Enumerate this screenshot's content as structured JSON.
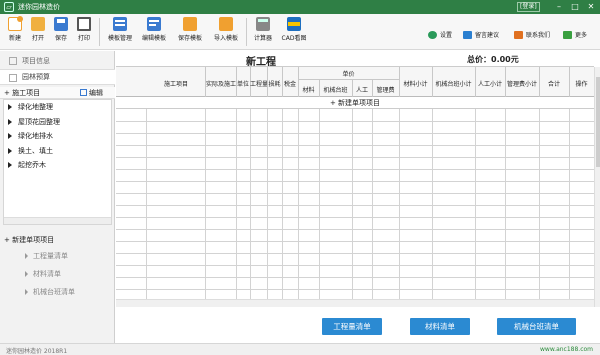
{
  "app": {
    "title": "迷你园林造价",
    "login": "[登录]"
  },
  "toolbar": {
    "items": [
      {
        "label": "新建",
        "icon": "new-file-icon",
        "color": "#f0a030"
      },
      {
        "label": "打开",
        "icon": "open-folder-icon",
        "color": "#f0b040"
      },
      {
        "label": "保存",
        "icon": "save-icon",
        "color": "#3a7ad0"
      },
      {
        "label": "打印",
        "icon": "print-icon",
        "color": "#555555"
      },
      {
        "label": "模板管理",
        "icon": "template-manage-icon",
        "color": "#3a7ad0"
      },
      {
        "label": "编辑模板",
        "icon": "edit-template-icon",
        "color": "#3a7ad0"
      },
      {
        "label": "保存模板",
        "icon": "save-template-icon",
        "color": "#f0a030"
      },
      {
        "label": "导入模板",
        "icon": "import-template-icon",
        "color": "#f0a030"
      },
      {
        "label": "计算器",
        "icon": "calculator-icon",
        "color": "#777777"
      },
      {
        "label": "CAD看图",
        "icon": "cad-viewer-icon",
        "color": "#1e6fc0"
      }
    ],
    "right": [
      {
        "label": "设置",
        "icon": "gear-icon",
        "color": "#2a9a5a"
      },
      {
        "label": "留言建议",
        "icon": "message-icon",
        "color": "#2a7fd0"
      },
      {
        "label": "联系我们",
        "icon": "mail-icon",
        "color": "#e07020"
      },
      {
        "label": "更多",
        "icon": "more-icon",
        "color": "#3aa040"
      }
    ]
  },
  "sidebar": {
    "tabs": [
      {
        "label": "项目信息"
      },
      {
        "label": "园林预算"
      }
    ],
    "tree_header": {
      "add_label": "+ 施工项目",
      "edit_label": "编辑"
    },
    "tree_items": [
      "绿化地整理",
      "屋顶花园整理",
      "绿化地排水",
      "换土、填土",
      "起挖乔木"
    ],
    "add_unit": "+ 新建单项项目",
    "links": [
      "工程量清单",
      "材料清单",
      "机械台班清单"
    ]
  },
  "main": {
    "project_title": "新工程",
    "total_label": "总价：0.00元",
    "columns": {
      "construction_item": "施工项目",
      "quantity": "实际及施工",
      "unit": "单位",
      "project_amount": "工程量",
      "tax_rate": "损耗",
      "tax": "税金",
      "unit_price_group": "单价",
      "material": "材料",
      "machinery_shift": "机械台班",
      "labor": "人工",
      "management_fee": "管理费",
      "material_subtotal": "材料小计",
      "machinery_subtotal": "机械台班小计",
      "labor_subtotal": "人工小计",
      "management_subtotal": "管理费小计",
      "total": "合计",
      "operation": "操作"
    },
    "add_unit_row": "+ 新建单项项目"
  },
  "buttons": {
    "quantity_list": "工程量清单",
    "material_list": "材料清单",
    "machinery_list": "机械台班清单"
  },
  "status": {
    "text": "迷你园林造价  2018R1",
    "url": "www.anc188.com"
  }
}
